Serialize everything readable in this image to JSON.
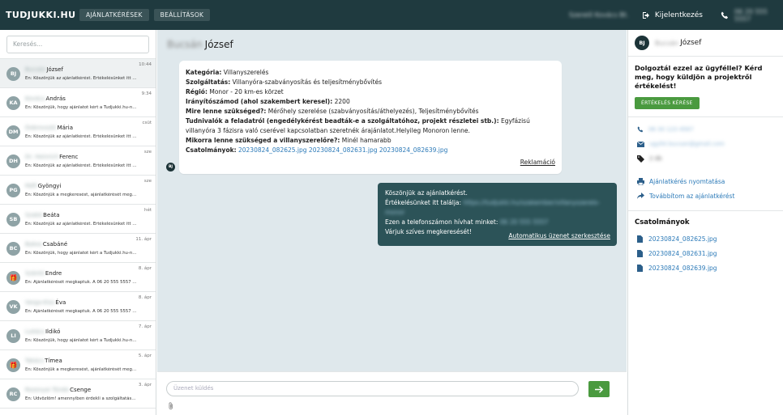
{
  "topbar": {
    "logo": "TUDJUKKI.HU",
    "nav": [
      "AJÁNLATKÉRÉSEK",
      "BEÁLLÍTÁSOK"
    ],
    "user_blurred": "Szerelő Kovács Bt.",
    "logout_label": "Kijelentkezés",
    "phone_blurred": "06 20 555 5557"
  },
  "left": {
    "search_placeholder": "Keresés...",
    "conversations": [
      {
        "initials": "BJ",
        "name_blur": "Bucsán",
        "name": "József",
        "time": "10:44",
        "preview": "Én: Köszönjük az ajánlatkérést. Értékelésünket itt található: https://tudjukki.hu",
        "active": true
      },
      {
        "initials": "KA",
        "name_blur": "Kovács",
        "name": "András",
        "time": "9:34",
        "preview": "Én: Köszönjük, hogy ajánlatot kért a Tudjukki.hu-n. Hamarosan keressük.",
        "active": false
      },
      {
        "initials": "DM",
        "name_blur": "Dobrovszki",
        "name": "Mária",
        "time": "csüt",
        "preview": "Én: Köszönjük az ajánlatkérést. Értékelésünket itt található: https://tudjukki.hu",
        "active": false
      },
      {
        "initials": "DH",
        "name_blur": "Dr. Heinrich",
        "name": "Ferenc",
        "time": "sze",
        "preview": "Én: Köszönjük az ajánlatkérést. Értékelésünket itt található: https://tudjukki.hu",
        "active": false
      },
      {
        "initials": "PG",
        "name_blur": "Pálfi",
        "name": "Gyöngyi",
        "time": "sze",
        "preview": "Én: Köszönjük a megkeresést, ajánlatkérését megkaptuk.",
        "active": false
      },
      {
        "initials": "SB",
        "name_blur": "Szabó",
        "name": "Beáta",
        "time": "hét",
        "preview": "Én: Köszönjük az ajánlatkérést. Értékelésünket itt található: https://tudjukki.hu",
        "active": false
      },
      {
        "initials": "BC",
        "name_blur": "Bakos",
        "name": "Csabáné",
        "time": "11. ápr",
        "preview": "Én: Köszönjük, hogy ajánlatot kért a Tudjukki.hu-n. Hamarosan keressük.",
        "active": false
      },
      {
        "initials": "🎁",
        "name_blur": "Szántó",
        "name": "Endre",
        "time": "8. ápr",
        "preview": "Én: Ajánlatkérését megkaptuk. A 06 20 555 5557 telefonszámon hívhat.",
        "active": false
      },
      {
        "initials": "VK",
        "name_blur": "Varga-Kiss",
        "name": "Éva",
        "time": "8. ápr",
        "preview": "Én: Ajánlatkérését megkaptuk. A 06 20 555 5557 telefonszámon hívhat.",
        "active": false
      },
      {
        "initials": "LI",
        "name_blur": "Lukács",
        "name": "Ildikó",
        "time": "7. ápr",
        "preview": "Én: Köszönjük, hogy ajánlatot kért a Tudjukki.hu-n. Hamarosan keressük.",
        "active": false
      },
      {
        "initials": "🎁",
        "name_blur": "Takács",
        "name": "Tímea",
        "time": "5. ápr",
        "preview": "Én: Köszönjük a megkeresést, ajánlatkérését megkaptuk.",
        "active": false
      },
      {
        "initials": "RC",
        "name_blur": "Rozsnyai Tünde",
        "name": "Csenge",
        "time": "3. ápr",
        "preview": "Én: Üdvözlöm! amennyiben érdekli a szolgáltatásunk, keressen bizalommal.",
        "active": false
      }
    ]
  },
  "center": {
    "header_blur": "Bucsán",
    "header_name": "József",
    "request": [
      {
        "label": "Kategória:",
        "value": "Villanyszerelés"
      },
      {
        "label": "Szolgáltatás:",
        "value": "Villanyóra-szabványosítás és teljesítménybővítés"
      },
      {
        "label": "Régió:",
        "value": "Monor - 20 km-es körzet"
      },
      {
        "label": "Irányítószámod (ahol szakembert keresel):",
        "value": "2200"
      },
      {
        "label": "Mire lenne szükséged?:",
        "value": "Mérőhely szerelése (szabványosítás/áthelyezés), Teljesítménybővítés"
      },
      {
        "label": "Tudnivalók a feladatról (engedélykérést beadták-e a szolgáltatóhoz, projekt részletei stb.):",
        "value": "Egyfázisú villanyóra 3 fázisra való cserével kapcsolatban szeretnék árajánlatot.Helyileg Monoron lenne."
      },
      {
        "label": "Mikorra lenne szükséged a villanyszerelőre?:",
        "value": "Minél hamarabb"
      }
    ],
    "attachments_label": "Csatolmányok:",
    "attachments": [
      "20230824_082625.jpg",
      "20230824_082631.jpg",
      "20230824_082639.jpg"
    ],
    "reklamacio": "Reklamáció",
    "sender_initials": "BJ",
    "reply": {
      "line1": "Köszönjük az ajánlatkérést.",
      "line2_prefix": "Értékelésünket itt találja:",
      "line2_blur": "https://tudjukki.hu/szakember/villanyszerelo-monor",
      "line3_prefix": "Ezen a telefonszámon hívhat minket:",
      "line3_blur": "06 20 555 5557",
      "line4": "Várjuk szíves megkeresését!",
      "edit_link": "Automatikus üzenet szerkesztése"
    },
    "composer_placeholder": "Üzenet küldés"
  },
  "right": {
    "initials": "BJ",
    "name_blur": "Bucsán",
    "name": "József",
    "question": "Dolgoztál ezzel az ügyféllel? Kérd meg, hogy küldjön a projektről értékelést!",
    "review_button": "ÉRTÉKELÉS KÉRÉSE",
    "phone_blur": "06 30 123 4567",
    "email_blur": "ugyfel.bucsan@gmail.com",
    "tag_blur": "2 db",
    "print_label": "Ajánlatkérés nyomtatása",
    "forward_label": "Továbbítom az ajánlatkérést",
    "attachments_title": "Csatolmányok",
    "attachments": [
      "20230824_082625.jpg",
      "20230824_082631.jpg",
      "20230824_082639.jpg"
    ]
  },
  "colors": {
    "topbar": "#1f3a3f",
    "accent_green": "#4a9a3f",
    "reply_bubble": "#2c5358",
    "link": "#2c7ab8",
    "chat_bg": "#dfe8ec"
  }
}
